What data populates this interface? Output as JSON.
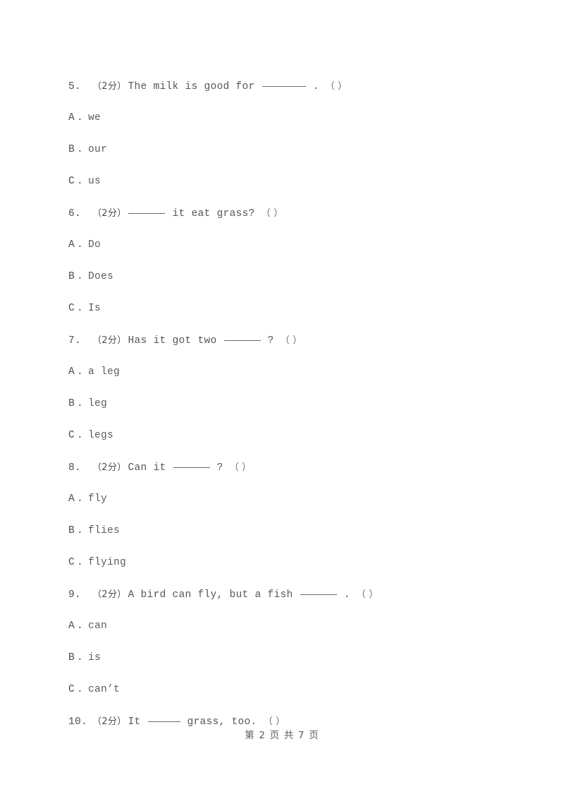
{
  "document": {
    "page_number_text": "第 2 页 共 7 页",
    "page_current": "2",
    "page_total": "7",
    "text_color": "#565656",
    "background_color": "#ffffff"
  },
  "questions": [
    {
      "number": "5.",
      "points": "（2分）",
      "stem_before": "The milk is good for",
      "blank": "long",
      "stem_after": ".",
      "answer_paren": "（      ）",
      "options": [
        {
          "letter": "A",
          "dot": ".",
          "text": "we"
        },
        {
          "letter": "B",
          "dot": ".",
          "text": "our"
        },
        {
          "letter": "C",
          "dot": ".",
          "text": "us"
        }
      ]
    },
    {
      "number": "6.",
      "points": "（2分）",
      "stem_before": "",
      "blank": "medium",
      "stem_after": "it eat grass?",
      "answer_paren": "（      ）",
      "options": [
        {
          "letter": "A",
          "dot": ".",
          "text": "Do"
        },
        {
          "letter": "B",
          "dot": ".",
          "text": "Does"
        },
        {
          "letter": "C",
          "dot": ".",
          "text": "Is"
        }
      ]
    },
    {
      "number": "7.",
      "points": "（2分）",
      "stem_before": "Has it got two",
      "blank": "medium",
      "stem_after": "?",
      "answer_paren": "（      ）",
      "options": [
        {
          "letter": "A",
          "dot": ".",
          "text": "a leg"
        },
        {
          "letter": "B",
          "dot": ".",
          "text": "leg"
        },
        {
          "letter": "C",
          "dot": ".",
          "text": "legs"
        }
      ]
    },
    {
      "number": "8.",
      "points": "（2分）",
      "stem_before": "Can it",
      "blank": "medium",
      "stem_after": "?",
      "answer_paren": "（      ）",
      "options": [
        {
          "letter": "A",
          "dot": ".",
          "text": "fly"
        },
        {
          "letter": "B",
          "dot": ".",
          "text": "flies"
        },
        {
          "letter": "C",
          "dot": ".",
          "text": "flying"
        }
      ]
    },
    {
      "number": "9.",
      "points": "（2分）",
      "stem_before": "A bird can fly, but a fish",
      "blank": "medium",
      "stem_after": ".",
      "answer_paren": "（      ）",
      "options": [
        {
          "letter": "A",
          "dot": ".",
          "text": "can"
        },
        {
          "letter": "B",
          "dot": ".",
          "text": "is"
        },
        {
          "letter": "C",
          "dot": ".",
          "text": "can’t"
        }
      ]
    },
    {
      "number": "10.",
      "points": "（2分）",
      "stem_before": "It",
      "blank": "small",
      "stem_after": "grass, too.",
      "answer_paren": "（      ）",
      "options": []
    }
  ]
}
